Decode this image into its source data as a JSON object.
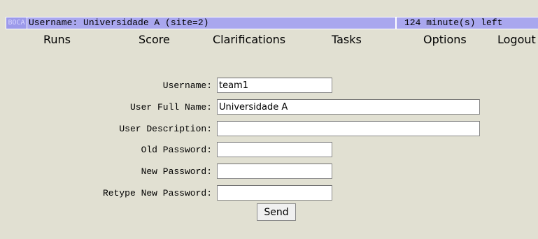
{
  "header": {
    "logo": "BOCA",
    "user_text": "Username: Universidade A (site=2)",
    "time_left": "124 minute(s) left"
  },
  "menu": {
    "runs": "Runs",
    "score": "Score",
    "clarifications": "Clarifications",
    "tasks": "Tasks",
    "options": "Options",
    "logout": "Logout"
  },
  "form": {
    "username_label": "Username:",
    "username_value": "team1",
    "fullname_label": "User Full Name:",
    "fullname_value": "Universidade A",
    "description_label": "User Description:",
    "description_value": "",
    "old_password_label": "Old Password:",
    "old_password_value": "",
    "new_password_label": "New Password:",
    "new_password_value": "",
    "retype_password_label": "Retype New Password:",
    "retype_password_value": "",
    "send_label": "Send"
  }
}
